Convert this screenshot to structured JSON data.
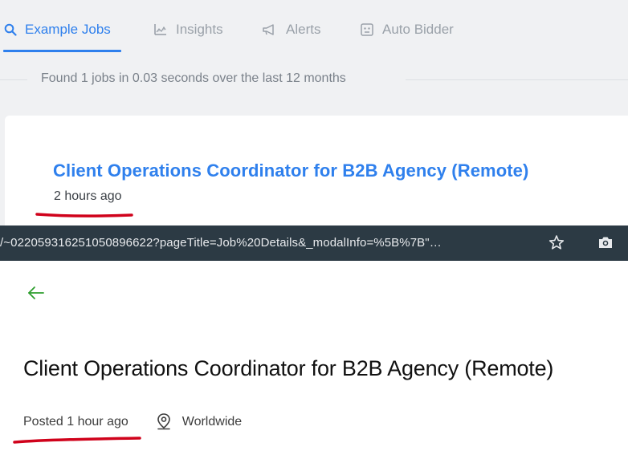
{
  "tabs": [
    {
      "label": "Example Jobs",
      "icon": "search-icon",
      "active": true
    },
    {
      "label": "Insights",
      "icon": "chart-icon",
      "active": false
    },
    {
      "label": "Alerts",
      "icon": "megaphone-icon",
      "active": false
    },
    {
      "label": "Auto Bidder",
      "icon": "robot-icon",
      "active": false
    }
  ],
  "results": {
    "summary": "Found 1 jobs in 0.03 seconds over the last 12 months"
  },
  "job_card": {
    "title": "Client Operations Coordinator for B2B Agency (Remote)",
    "time": "2 hours ago"
  },
  "browser": {
    "url": "/~022059316251050896622?pageTitle=Job%20Details&_modalInfo=%5B%7B\"…"
  },
  "detail": {
    "title": "Client Operations Coordinator for B2B Agency (Remote)",
    "posted": "Posted 1 hour ago",
    "location": "Worldwide"
  },
  "colors": {
    "accent": "#2f80ed",
    "annotation": "#d0021b",
    "back_arrow": "#2e9e2e"
  }
}
